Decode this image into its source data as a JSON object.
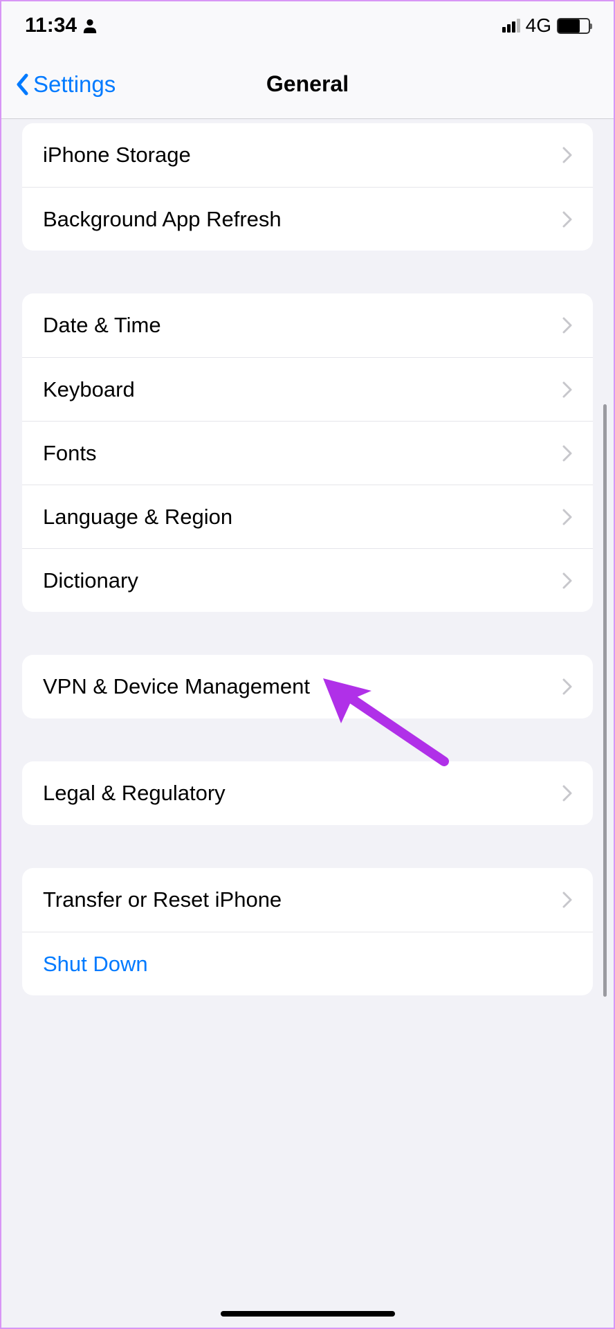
{
  "status": {
    "time": "11:34",
    "network": "4G"
  },
  "nav": {
    "back": "Settings",
    "title": "General"
  },
  "groups": [
    {
      "rows": [
        {
          "label": "iPhone Storage",
          "name": "iphone-storage",
          "chevron": true
        },
        {
          "label": "Background App Refresh",
          "name": "background-app-refresh",
          "chevron": true
        }
      ]
    },
    {
      "rows": [
        {
          "label": "Date & Time",
          "name": "date-time",
          "chevron": true
        },
        {
          "label": "Keyboard",
          "name": "keyboard",
          "chevron": true
        },
        {
          "label": "Fonts",
          "name": "fonts",
          "chevron": true
        },
        {
          "label": "Language & Region",
          "name": "language-region",
          "chevron": true
        },
        {
          "label": "Dictionary",
          "name": "dictionary",
          "chevron": true
        }
      ]
    },
    {
      "rows": [
        {
          "label": "VPN & Device Management",
          "name": "vpn-device-management",
          "chevron": true
        }
      ]
    },
    {
      "rows": [
        {
          "label": "Legal & Regulatory",
          "name": "legal-regulatory",
          "chevron": true
        }
      ]
    },
    {
      "rows": [
        {
          "label": "Transfer or Reset iPhone",
          "name": "transfer-reset",
          "chevron": true
        },
        {
          "label": "Shut Down",
          "name": "shut-down",
          "chevron": false,
          "action": true
        }
      ]
    }
  ]
}
